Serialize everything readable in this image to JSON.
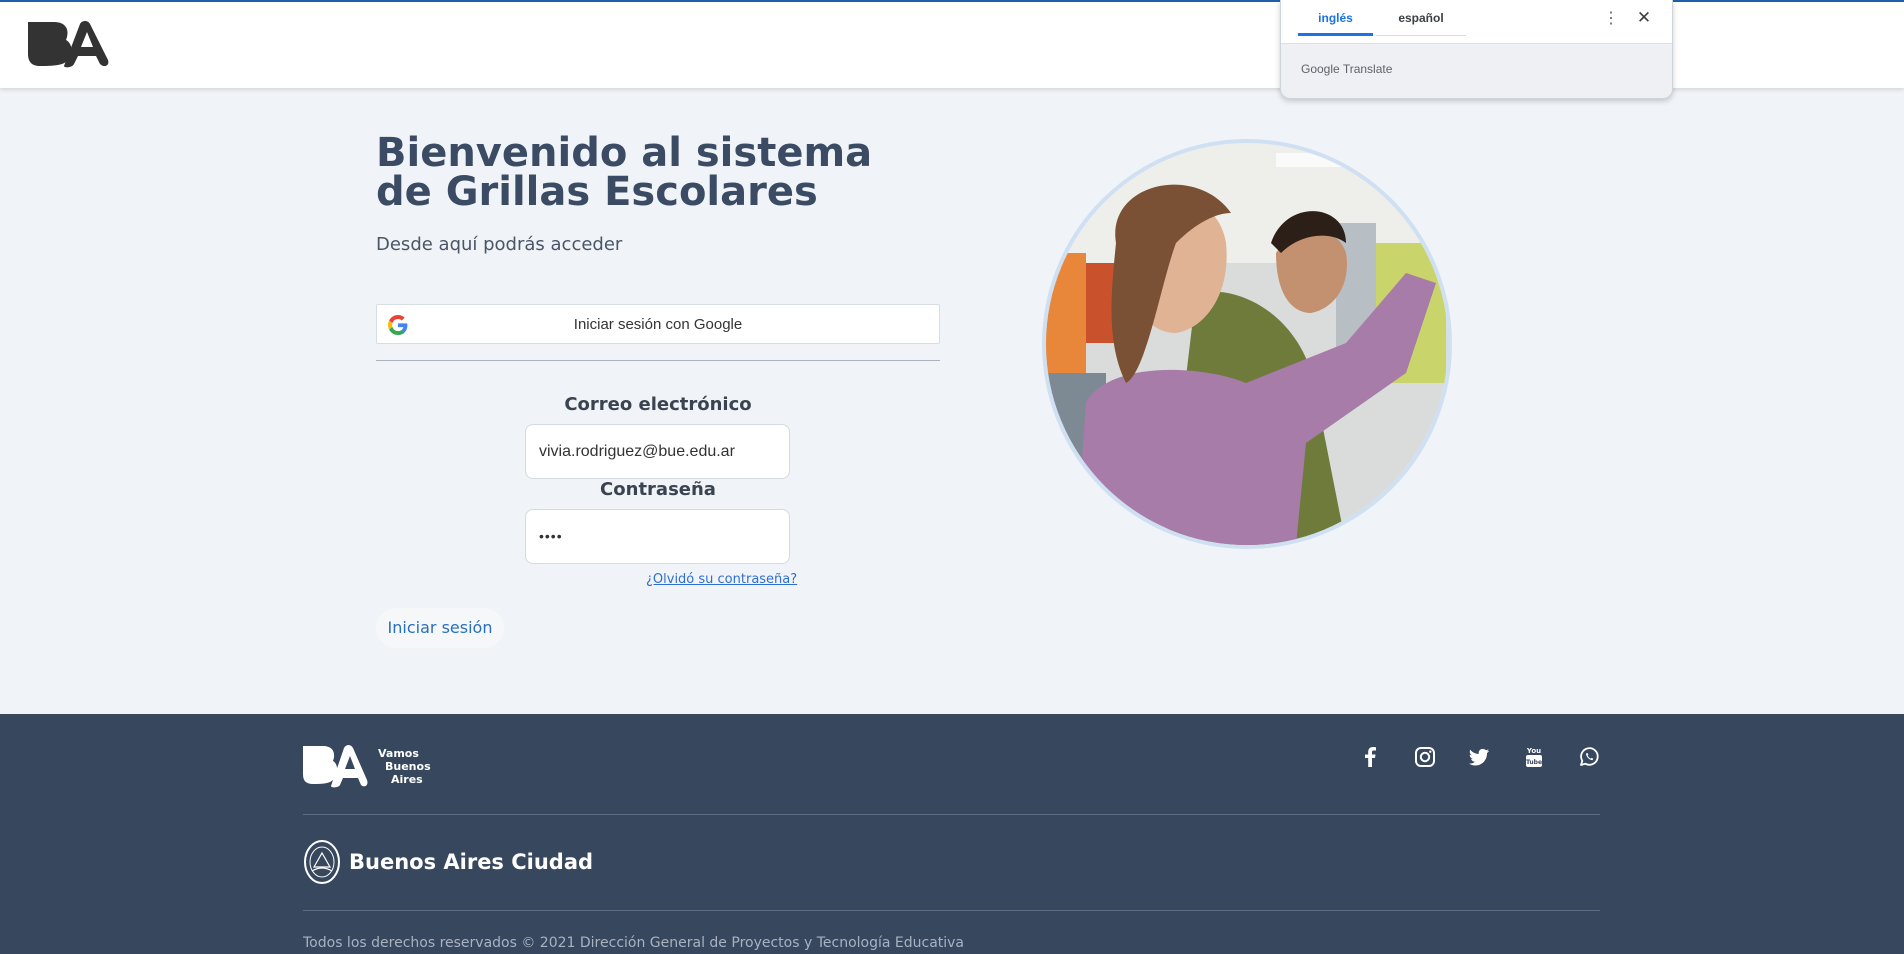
{
  "header": {
    "logo_text": "BA"
  },
  "translate_popup": {
    "tabs": [
      "inglés",
      "español"
    ],
    "active_tab": "inglés",
    "brand_google": "Google",
    "brand_translate": "Translate",
    "more_icon": "vertical-dots-icon",
    "close_icon": "close-icon"
  },
  "main": {
    "title": "Bienvenido al sistema de Grillas Escolares",
    "subtitle": "Desde aquí podrás acceder",
    "google_button": "Iniciar sesión con Google",
    "email_label": "Correo electrónico",
    "email_value": "vivia.rodriguez@bue.edu.ar",
    "password_label": "Contraseña",
    "password_value": "••••",
    "forgot_link": "¿Olvidó su contraseña?",
    "login_button": "Iniciar sesión"
  },
  "footer": {
    "logo_text_lines": [
      "Vamos",
      "Buenos",
      "Aires"
    ],
    "social_icons": [
      "facebook-icon",
      "instagram-icon",
      "twitter-icon",
      "youtube-icon",
      "whatsapp-icon"
    ],
    "city_name": "Buenos Aires Ciudad",
    "copyright": "Todos los derechos reservados © 2021 Dirección General de Proyectos y Tecnología Educativa"
  },
  "colors": {
    "accent": "#2a6fbd",
    "footer_bg": "#37475d",
    "page_bg": "#f0f4f8",
    "translate_blue": "#1a73e8"
  }
}
